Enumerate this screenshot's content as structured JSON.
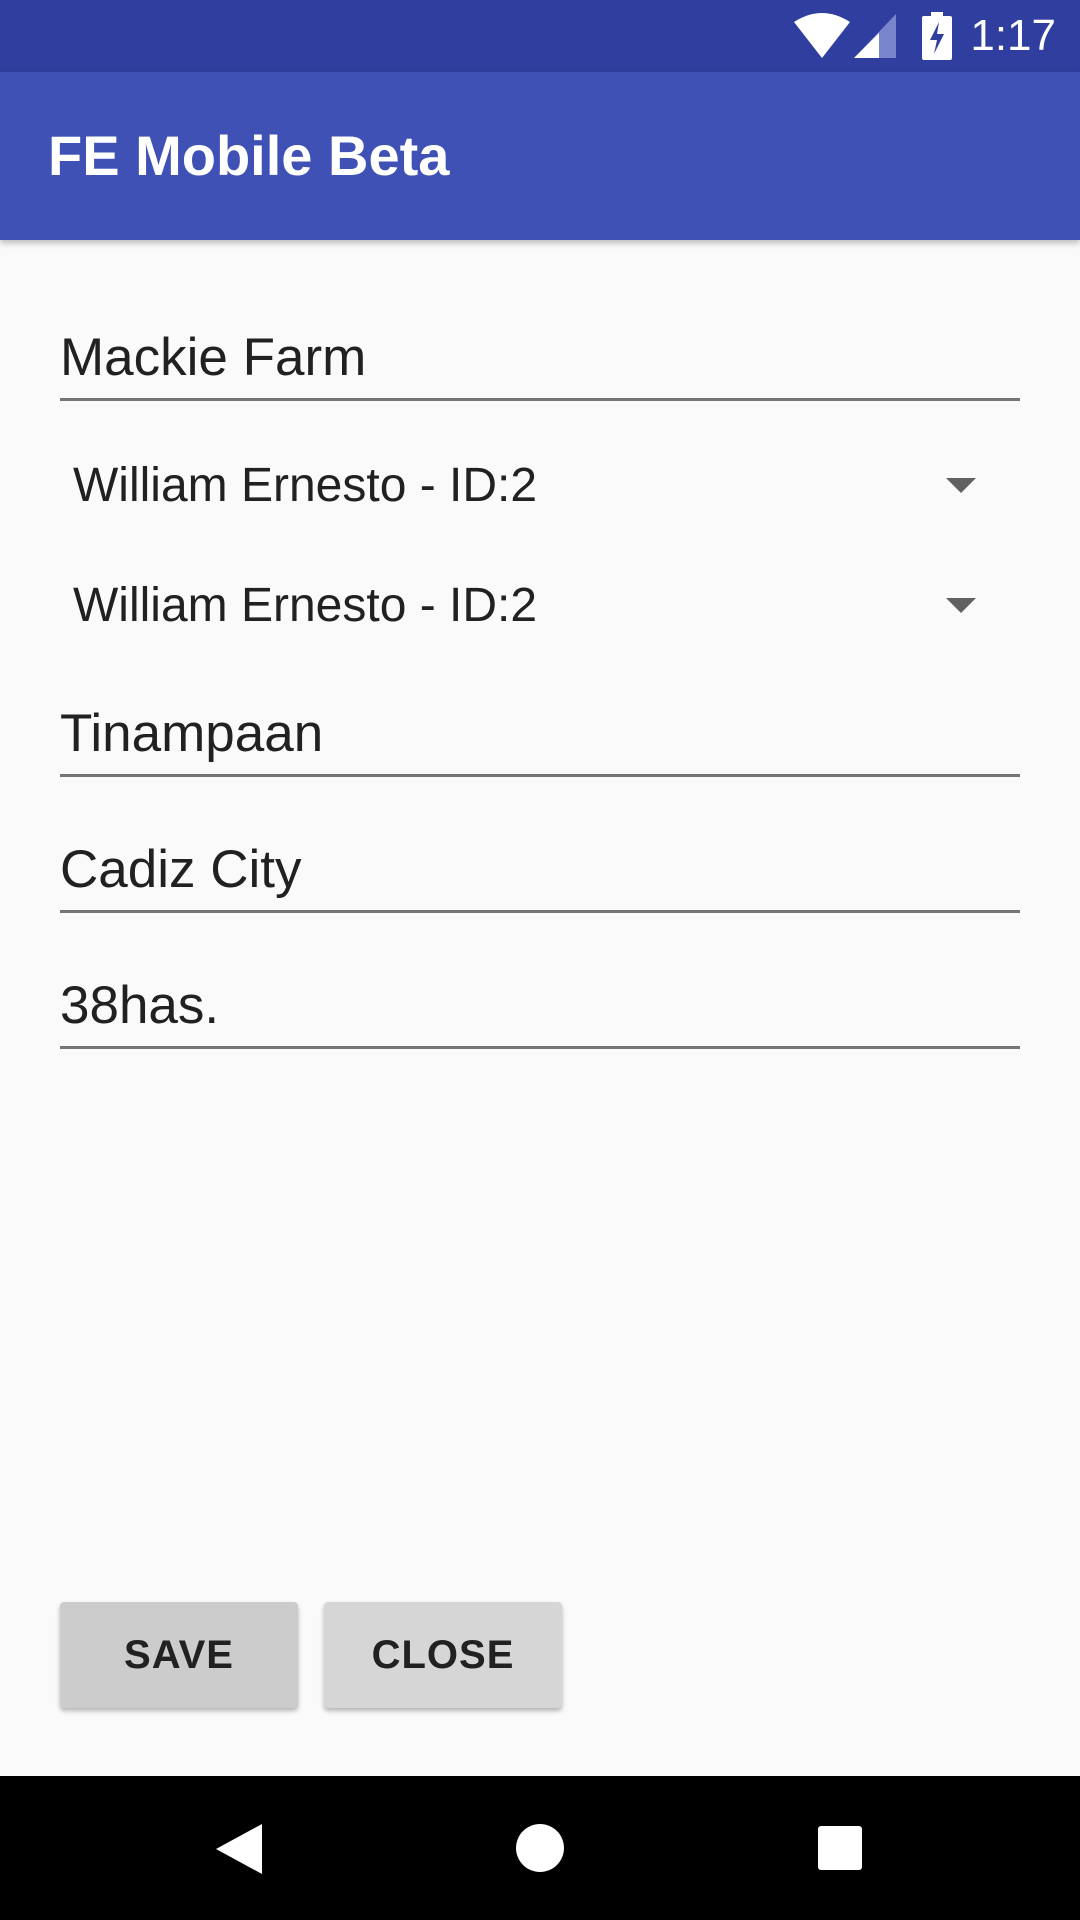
{
  "status_bar": {
    "time": "1:17",
    "icons": [
      "wifi-icon",
      "cell-signal-icon",
      "battery-charging-icon"
    ],
    "color": "#303f9f"
  },
  "app_bar": {
    "title": "FE Mobile Beta",
    "color": "#3f51b5"
  },
  "form": {
    "farm_name": "Mackie Farm",
    "spinner_1": "William Ernesto - ID:2",
    "spinner_2": "William Ernesto - ID:2",
    "barangay": "Tinampaan",
    "city": "Cadiz City",
    "area": "38has."
  },
  "buttons": {
    "save": "SAVE",
    "close": "CLOSE"
  },
  "nav_bar": {
    "icons": [
      "back-icon",
      "home-icon",
      "recents-icon"
    ]
  }
}
